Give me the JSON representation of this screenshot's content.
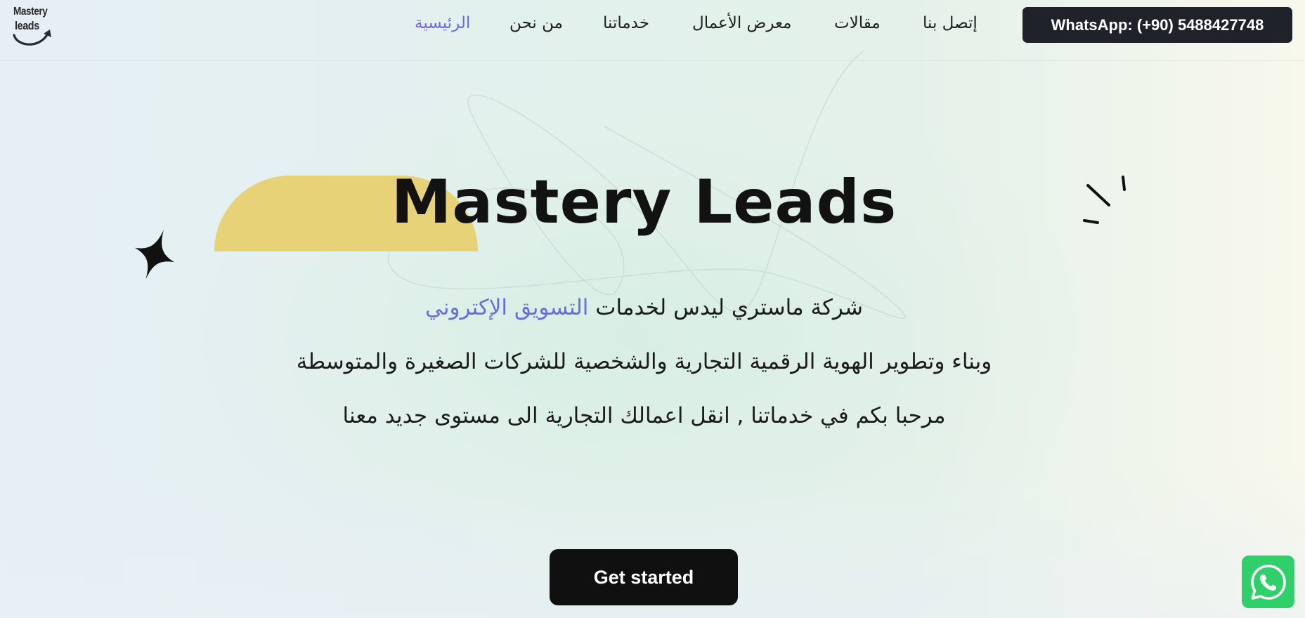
{
  "logo": {
    "line1": "Mastery",
    "line2": "leads"
  },
  "nav": {
    "home": "الرئيسية",
    "about": "من نحن",
    "services": "خدماتنا",
    "portfolio": "معرض الأعمال",
    "articles": "مقالات",
    "contact": "إتصل بنا"
  },
  "whatsapp_button": "WhatsApp: (+90) 5488427748",
  "hero": {
    "title": "Mastery Leads",
    "line1_prefix": "شركة ماستري ليدس لخدمات",
    "line1_highlight": "التسويق الإكتروني",
    "line2": "وبناء وتطوير الهوية الرقمية التجارية والشخصية للشركات الصغيرة والمتوسطة",
    "line3": "مرحبا بكم في خدماتنا , انقل اعمالك التجارية الى مستوى جديد معنا",
    "cta": "Get started"
  },
  "icons": {
    "sparkle": "four-point-star-icon",
    "accent": "accent-lines-icon",
    "whatsapp": "whatsapp-icon"
  },
  "colors": {
    "accent": "#6b6be0",
    "dark": "#1f2329",
    "yellow": "#e8d277",
    "whatsapp": "#2fd06a"
  }
}
